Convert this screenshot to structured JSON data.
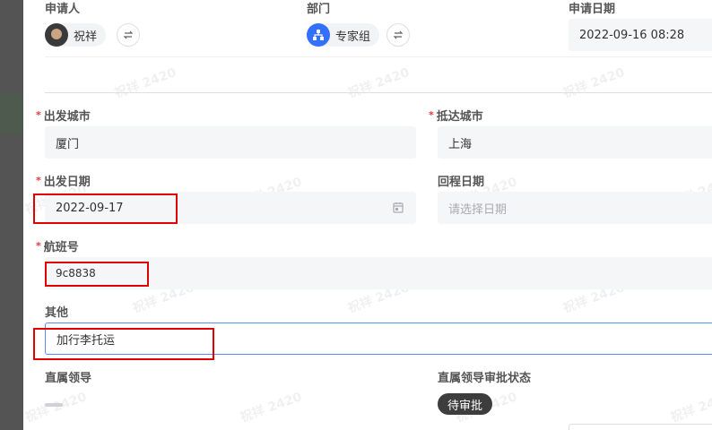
{
  "header": {
    "applicant_label": "申请人",
    "applicant_name": "祝祥",
    "department_label": "部门",
    "department_name": "专家组",
    "apply_date_label": "申请日期",
    "apply_date_value": "2022-09-16 08:28"
  },
  "form": {
    "depart_city_label": "出发城市",
    "depart_city_value": "厦门",
    "arrive_city_label": "抵达城市",
    "arrive_city_value": "上海",
    "depart_date_label": "出发日期",
    "depart_date_value": "2022-09-17",
    "return_date_label": "回程日期",
    "return_date_placeholder": "请选择日期",
    "flight_label": "航班号",
    "flight_value": "9c8838",
    "other_label": "其他",
    "other_value": "加行李托运",
    "leader_label": "直属领导",
    "leader_status_label": "直属领导审批状态",
    "leader_status_value": "待审批",
    "required_mark": "*"
  },
  "watermark": "祝祥 2420",
  "colors": {
    "accent": "#3370ff",
    "required": "#e5383b",
    "highlight": "#e00000",
    "status_tag": "#3d3d3d"
  }
}
